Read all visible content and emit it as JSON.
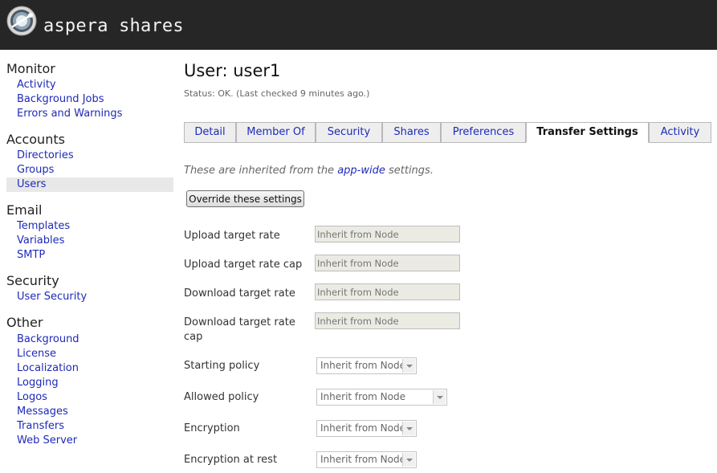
{
  "header": {
    "app_title": "aspera shares",
    "logo_icon": "aspera-logo-icon"
  },
  "sidebar": {
    "sections": [
      {
        "title": "Monitor",
        "items": [
          "Activity",
          "Background Jobs",
          "Errors and Warnings"
        ]
      },
      {
        "title": "Accounts",
        "items": [
          "Directories",
          "Groups",
          "Users"
        ]
      },
      {
        "title": "Email",
        "items": [
          "Templates",
          "Variables",
          "SMTP"
        ]
      },
      {
        "title": "Security",
        "items": [
          "User Security"
        ]
      },
      {
        "title": "Other",
        "items": [
          "Background",
          "License",
          "Localization",
          "Logging",
          "Logos",
          "Messages",
          "Transfers",
          "Web Server"
        ]
      }
    ],
    "active_item": "Users"
  },
  "main": {
    "title": "User: user1",
    "status": "Status: OK. (Last checked 9 minutes ago.)",
    "tabs": [
      "Detail",
      "Member Of",
      "Security",
      "Shares",
      "Preferences",
      "Transfer Settings",
      "Activity"
    ],
    "active_tab": "Transfer Settings",
    "note_prefix": "These are inherited from the ",
    "note_link": "app-wide",
    "note_suffix": " settings.",
    "override_button": "Override these settings",
    "fields": [
      {
        "label": "Upload target rate",
        "placeholder": "Inherit from Node"
      },
      {
        "label": "Upload target rate cap",
        "placeholder": "Inherit from Node"
      },
      {
        "label": "Download target rate",
        "placeholder": "Inherit from Node"
      },
      {
        "label": "Download target rate cap",
        "placeholder": "Inherit from Node"
      }
    ],
    "selects": [
      {
        "label": "Starting policy",
        "value": "Inherit from Node"
      },
      {
        "label": "Allowed policy",
        "value": "Inherit from Node"
      },
      {
        "label": "Encryption",
        "value": "Inherit from Node"
      },
      {
        "label": "Encryption at rest",
        "value": "Inherit from Node"
      }
    ]
  },
  "colors": {
    "header_bg": "#262626",
    "link": "#1e2ab8",
    "active_item_bg": "#e8e8e8"
  }
}
